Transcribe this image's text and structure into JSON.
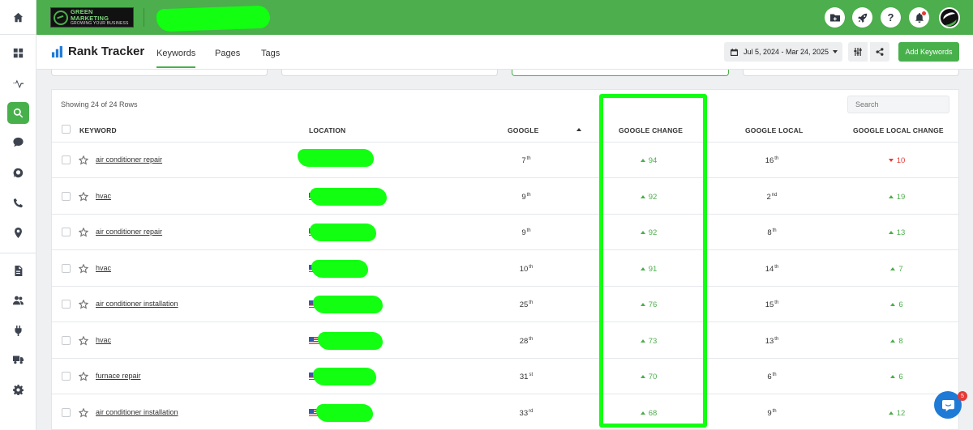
{
  "brand": {
    "line1": "GREEN MARKETING",
    "line2": "GROWING YOUR BUSINESS"
  },
  "sidebar": {
    "icons": [
      "home-icon",
      "dashboard-icon",
      "activity-icon",
      "search-icon",
      "chat-icon",
      "reviews-icon",
      "phone-icon",
      "location-icon",
      "report-icon",
      "users-icon",
      "integrations-icon",
      "truck-icon",
      "settings-icon"
    ],
    "active": "search-icon"
  },
  "topbar": {
    "buttons": [
      "add-folder-icon",
      "rocket-icon",
      "help-icon",
      "notification-icon"
    ],
    "help_label": "?"
  },
  "header": {
    "title": "Rank Tracker",
    "tabs": [
      "Keywords",
      "Pages",
      "Tags"
    ],
    "active_tab": "Keywords",
    "date_range": "Jul 5, 2024 - Mar 24, 2025",
    "add_button": "Add Keywords"
  },
  "table": {
    "showing": "Showing 24 of 24 Rows",
    "search_placeholder": "Search",
    "columns": {
      "keyword": "KEYWORD",
      "location": "LOCATION",
      "google": "GOOGLE",
      "google_change": "GOOGLE CHANGE",
      "google_local": "GOOGLE LOCAL",
      "google_local_change": "GOOGLE LOCAL CHANGE"
    },
    "sorted_column": "GOOGLE",
    "rows": [
      {
        "keyword": "air conditioner repair",
        "google_num": "7",
        "google_suf": "th",
        "change": "94",
        "change_dir": "up",
        "local_num": "16",
        "local_suf": "th",
        "local_change": "10",
        "local_change_dir": "down"
      },
      {
        "keyword": "hvac",
        "google_num": "9",
        "google_suf": "th",
        "change": "92",
        "change_dir": "up",
        "local_num": "2",
        "local_suf": "nd",
        "local_change": "19",
        "local_change_dir": "up"
      },
      {
        "keyword": "air conditioner repair",
        "google_num": "9",
        "google_suf": "th",
        "change": "92",
        "change_dir": "up",
        "local_num": "8",
        "local_suf": "th",
        "local_change": "13",
        "local_change_dir": "up"
      },
      {
        "keyword": "hvac",
        "google_num": "10",
        "google_suf": "th",
        "change": "91",
        "change_dir": "up",
        "local_num": "14",
        "local_suf": "th",
        "local_change": "7",
        "local_change_dir": "up"
      },
      {
        "keyword": "air conditioner installation",
        "google_num": "25",
        "google_suf": "th",
        "change": "76",
        "change_dir": "up",
        "local_num": "15",
        "local_suf": "th",
        "local_change": "6",
        "local_change_dir": "up"
      },
      {
        "keyword": "hvac",
        "google_num": "28",
        "google_suf": "th",
        "change": "73",
        "change_dir": "up",
        "local_num": "13",
        "local_suf": "th",
        "local_change": "8",
        "local_change_dir": "up"
      },
      {
        "keyword": "furnace repair",
        "google_num": "31",
        "google_suf": "st",
        "change": "70",
        "change_dir": "up",
        "local_num": "6",
        "local_suf": "th",
        "local_change": "6",
        "local_change_dir": "up"
      },
      {
        "keyword": "air conditioner installation",
        "google_num": "33",
        "google_suf": "rd",
        "change": "68",
        "change_dir": "up",
        "local_num": "9",
        "local_suf": "th",
        "local_change": "12",
        "local_change_dir": "up"
      }
    ]
  },
  "chat": {
    "badge": "5"
  },
  "colors": {
    "brand_green": "#4cae4c",
    "highlight": "#12ff12",
    "up": "#4cae4c",
    "down": "#e53935",
    "chat": "#1f7ad6"
  }
}
